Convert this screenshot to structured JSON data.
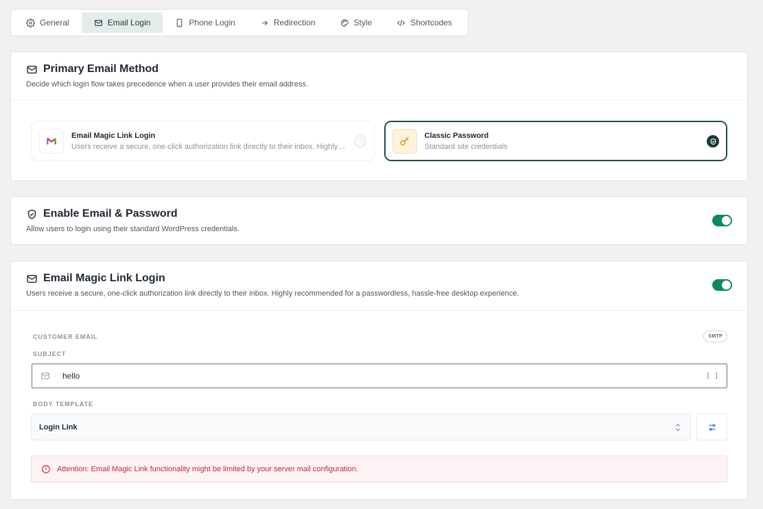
{
  "tabs": [
    {
      "label": "General",
      "icon": "gear-icon",
      "active": false
    },
    {
      "label": "Email Login",
      "icon": "mail-icon",
      "active": true
    },
    {
      "label": "Phone Login",
      "icon": "phone-icon",
      "active": false
    },
    {
      "label": "Redirection",
      "icon": "arrow-right-icon",
      "active": false
    },
    {
      "label": "Style",
      "icon": "palette-icon",
      "active": false
    },
    {
      "label": "Shortcodes",
      "icon": "code-icon",
      "active": false
    }
  ],
  "primary": {
    "title": "Primary Email Method",
    "description": "Decide which login flow takes precedence when a user provides their email address.",
    "options": [
      {
        "title": "Email Magic Link Login",
        "description": "Users receive a secure, one-click authorization link directly to their inbox. Highly recommended for a passwordless, hassle-free desktop experience.",
        "selected": false,
        "icon": "gmail-icon"
      },
      {
        "title": "Classic Password",
        "description": "Standard site credentials",
        "selected": true,
        "icon": "key-icon"
      }
    ]
  },
  "password_section": {
    "title": "Enable Email & Password",
    "description": "Allow users to login using their standard WordPress credentials.",
    "enabled": true
  },
  "magic_link": {
    "title": "Email Magic Link Login",
    "description": "Users receive a secure, one-click authorization link directly to their inbox. Highly recommended for a passwordless, hassle-free desktop experience.",
    "enabled": true,
    "customer_email_label": "CUSTOMER EMAIL",
    "smtp_badge": "SMTP",
    "subject_label": "SUBJECT",
    "subject_value": "hello",
    "bracket_glyph": "[ ]",
    "body_template_label": "BODY TEMPLATE",
    "body_template_value": "Login Link",
    "alert": "Attention: Email Magic Link functionality might be limited by your server mail configuration."
  },
  "colors": {
    "accent": "#0f8a5f",
    "selected_border": "#1d4b46",
    "alert_text": "#c0264a",
    "active_tab_bg": "#e3ecea"
  }
}
